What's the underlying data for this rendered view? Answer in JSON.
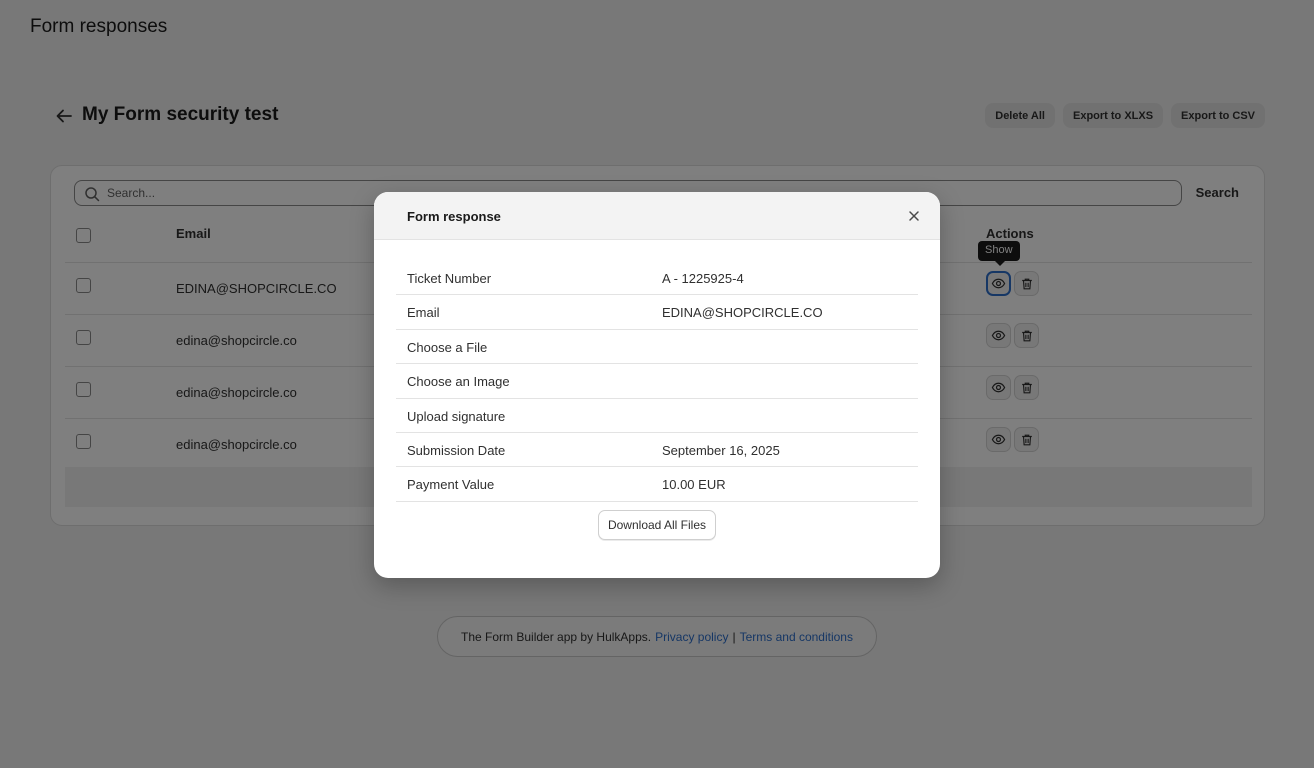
{
  "page": {
    "header": "Form responses",
    "form_title": "My Form security test",
    "actions": {
      "delete_all": "Delete All",
      "export_xlsx": "Export to XLXS",
      "export_csv": "Export to CSV"
    }
  },
  "search": {
    "placeholder": "Search...",
    "button_label": "Search"
  },
  "table": {
    "columns": {
      "email": "Email",
      "actions": "Actions"
    },
    "rows": [
      {
        "email": "EDINA@SHOPCIRCLE.CO"
      },
      {
        "email": "edina@shopcircle.co"
      },
      {
        "email": "edina@shopcircle.co"
      },
      {
        "email": "edina@shopcircle.co"
      }
    ],
    "tooltip": "Show"
  },
  "modal": {
    "title": "Form response",
    "fields": [
      {
        "label": "Ticket Number",
        "value": "A - 1225925-4"
      },
      {
        "label": "Email",
        "value": "EDINA@SHOPCIRCLE.CO"
      },
      {
        "label": "Choose a File",
        "value": ""
      },
      {
        "label": "Choose an Image",
        "value": ""
      },
      {
        "label": "Upload signature",
        "value": ""
      },
      {
        "label": "Submission Date",
        "value": "September 16, 2025"
      },
      {
        "label": "Payment Value",
        "value": "10.00 EUR"
      }
    ],
    "download_label": "Download All Files"
  },
  "footer": {
    "text": "The Form Builder app by HulkApps.",
    "privacy": "Privacy policy",
    "separator": "|",
    "terms": "Terms and conditions"
  },
  "colors": {
    "link": "#2c6ecb",
    "focus": "#2c6ecb",
    "tooltip_bg": "#1a1a1a"
  },
  "icons": [
    "arrow-left-icon",
    "search-icon",
    "eye-icon",
    "trash-icon",
    "close-icon"
  ]
}
